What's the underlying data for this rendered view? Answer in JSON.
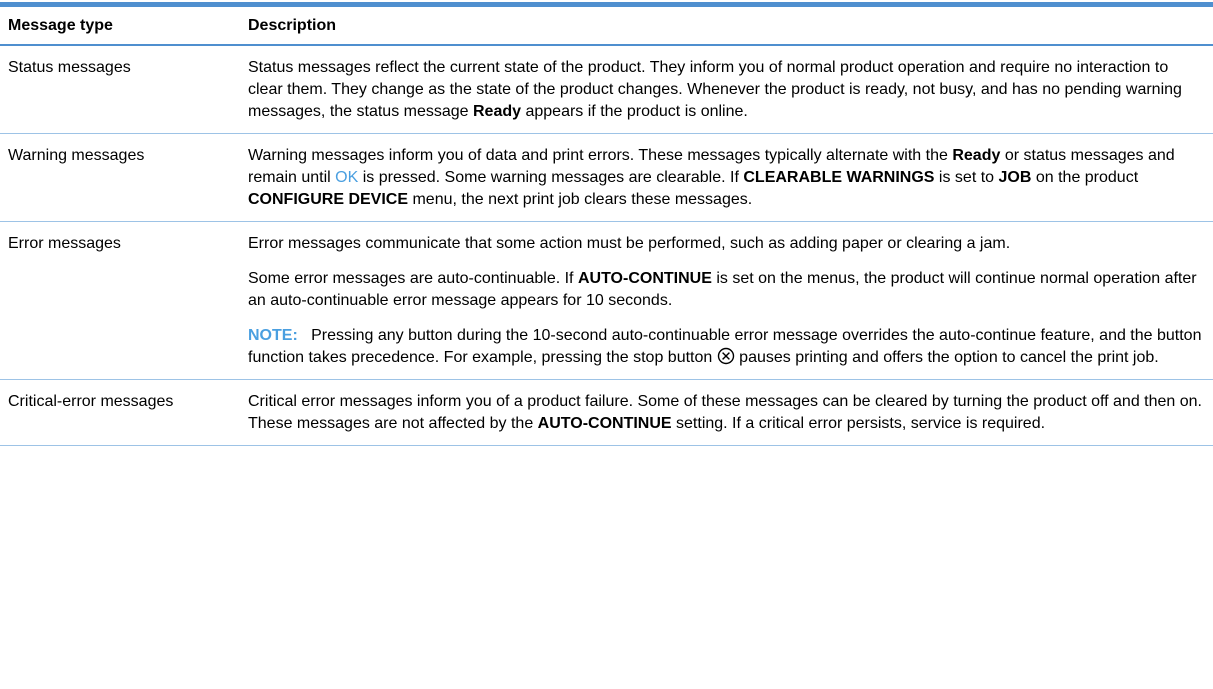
{
  "table": {
    "headers": {
      "type": "Message type",
      "description": "Description"
    },
    "rows": [
      {
        "type": "Status messages",
        "desc": {
          "t1": "Status messages reflect the current state of the product. They inform you of normal product operation and require no interaction to clear them. They change as the state of the product changes. Whenever the product is ready, not busy, and has no pending warning messages, the status message ",
          "b1": "Ready",
          "t2": " appears if the product is online."
        }
      },
      {
        "type": "Warning messages",
        "desc": {
          "t1": "Warning messages inform you of data and print errors. These messages typically alternate with the ",
          "b1": "Ready",
          "t2": " or status messages and remain until ",
          "ok": "OK",
          "t3": " is pressed. Some warning messages are clearable. If ",
          "b2": "CLEARABLE WARNINGS",
          "t4": " is set to ",
          "b3": "JOB",
          "t5": " on the product ",
          "b4": "CONFIGURE DEVICE",
          "t6": " menu, the next print job clears these messages."
        }
      },
      {
        "type": "Error messages",
        "p1": "Error messages communicate that some action must be performed, such as adding paper or clearing a jam.",
        "p2": {
          "t1": "Some error messages are auto-continuable. If ",
          "b1": "AUTO-CONTINUE",
          "t2": " is set on the menus, the product will continue normal operation after an auto-continuable error message appears for 10 seconds."
        },
        "note": {
          "label": "NOTE:",
          "t1": "Pressing any button during the 10-second auto-continuable error message overrides the auto-continue feature, and the button function takes precedence. For example, pressing the stop button ",
          "icon": "stop-button-icon",
          "t2": " pauses printing and offers the option to cancel the print job."
        }
      },
      {
        "type": "Critical-error messages",
        "desc": {
          "t1": "Critical error messages inform you of a product failure. Some of these messages can be cleared by turning the product off and then on. These messages are not affected by the ",
          "b1": "AUTO-CONTINUE",
          "t2": " setting. If a critical error persists, service is required."
        }
      }
    ]
  },
  "colors": {
    "rule": "#4f8fcf",
    "row_divider": "#9dc3e6",
    "accent": "#4a9fe0"
  }
}
